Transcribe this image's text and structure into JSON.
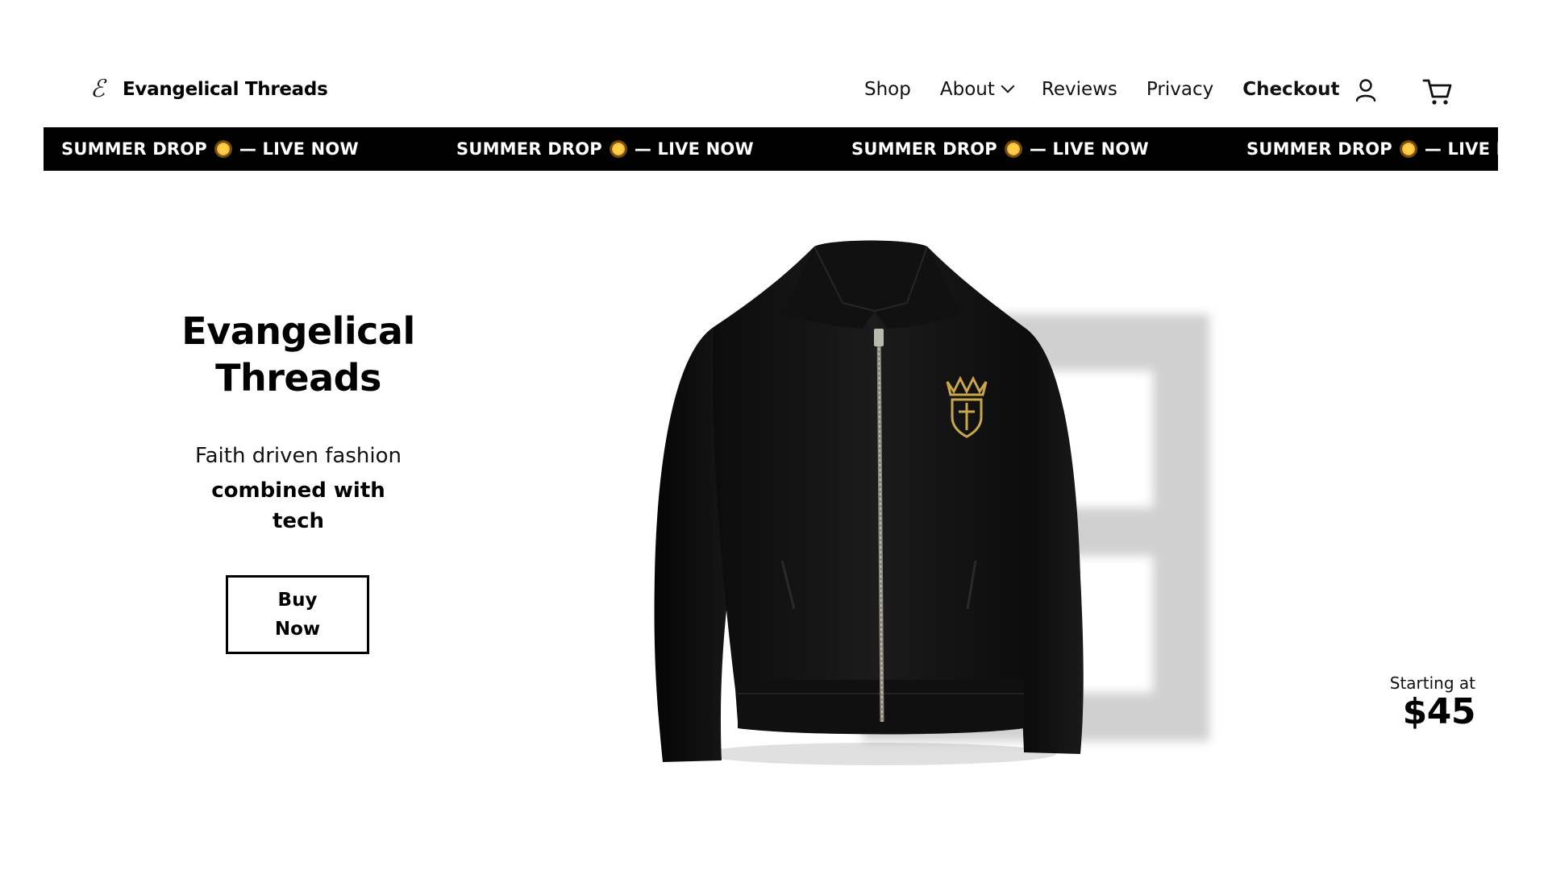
{
  "header": {
    "logo_mark": "ℰ",
    "brand": "Evangelical Threads",
    "nav": {
      "shop": "Shop",
      "about": "About",
      "reviews": "Reviews",
      "privacy": "Privacy",
      "checkout": "Checkout"
    },
    "icons": {
      "account": "user-icon",
      "cart": "cart-icon",
      "about_dropdown": "chevron-down-icon"
    }
  },
  "ticker": {
    "items": [
      {
        "left": "SUMMER DROP",
        "right": "— LIVE NOW"
      },
      {
        "left": "SUMMER DROP",
        "right": "— LIVE NOW"
      },
      {
        "left": "SUMMER DROP",
        "right": "— LIVE NOW"
      },
      {
        "left": "SUMMER DROP",
        "right": "— LIVE NOW"
      }
    ],
    "icon": "sun-icon",
    "background": "#000000",
    "text_color": "#ffffff"
  },
  "hero": {
    "title_line1": "Evangelical",
    "title_line2": "Threads",
    "subtitle": "Faith driven fashion",
    "subtitle_bold_line1": "combined with",
    "subtitle_bold_line2": "tech",
    "cta_line1": "Buy",
    "cta_line2": "Now"
  },
  "product": {
    "image": "black-zip-jacket-with-gold-crest",
    "price_label": "Starting at",
    "price": "$45",
    "crest_color": "#c9a64a"
  }
}
